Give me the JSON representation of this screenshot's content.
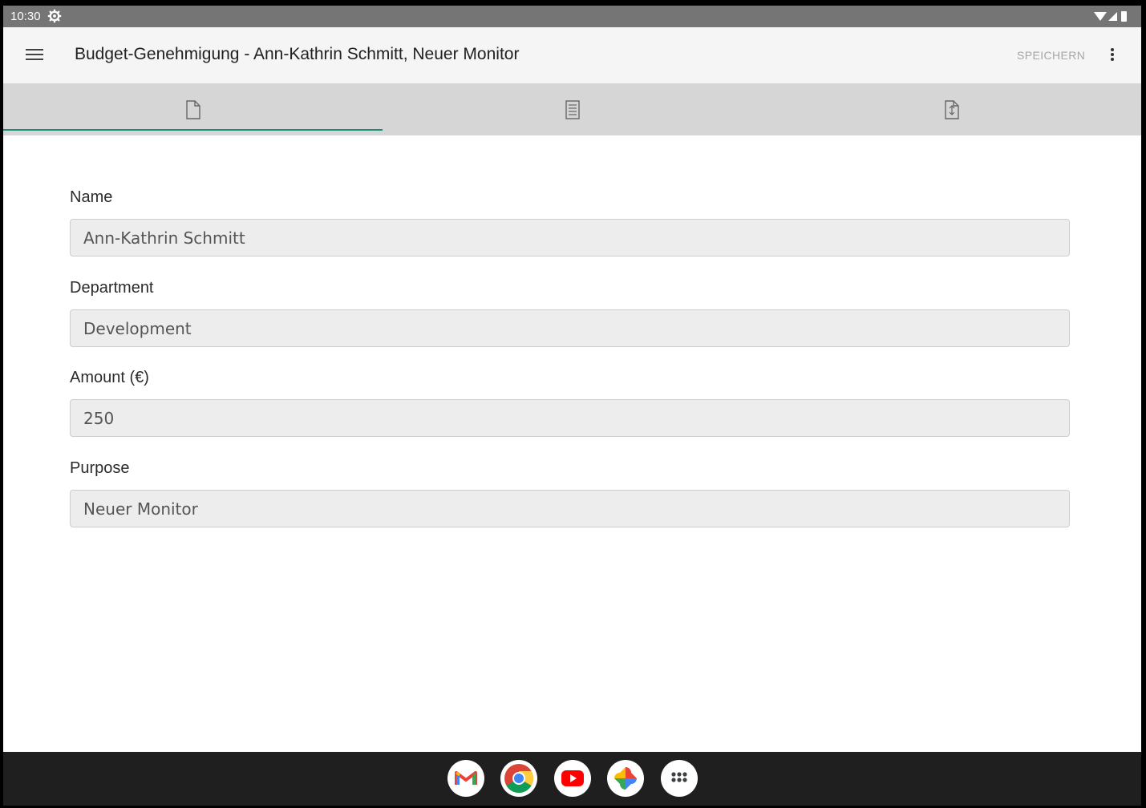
{
  "status_bar": {
    "time": "10:30"
  },
  "toolbar": {
    "title": "Budget-Genehmigung - Ann-Kathrin Schmitt, Neuer Monitor",
    "save_label": "SPEICHERN",
    "accent_color": "#1b8a77"
  },
  "tabs": [
    {
      "icon": "document-icon",
      "active": true
    },
    {
      "icon": "checklist-icon",
      "active": false
    },
    {
      "icon": "document-sign-icon",
      "active": false
    }
  ],
  "form": {
    "fields": [
      {
        "label": "Name",
        "value": "Ann-Kathrin Schmitt"
      },
      {
        "label": "Department",
        "value": "Development"
      },
      {
        "label": "Amount (€)",
        "value": "250"
      },
      {
        "label": "Purpose",
        "value": "Neuer Monitor"
      }
    ]
  },
  "dock": {
    "apps": [
      "gmail-icon",
      "chrome-icon",
      "youtube-icon",
      "photos-icon",
      "app-drawer-icon"
    ]
  }
}
